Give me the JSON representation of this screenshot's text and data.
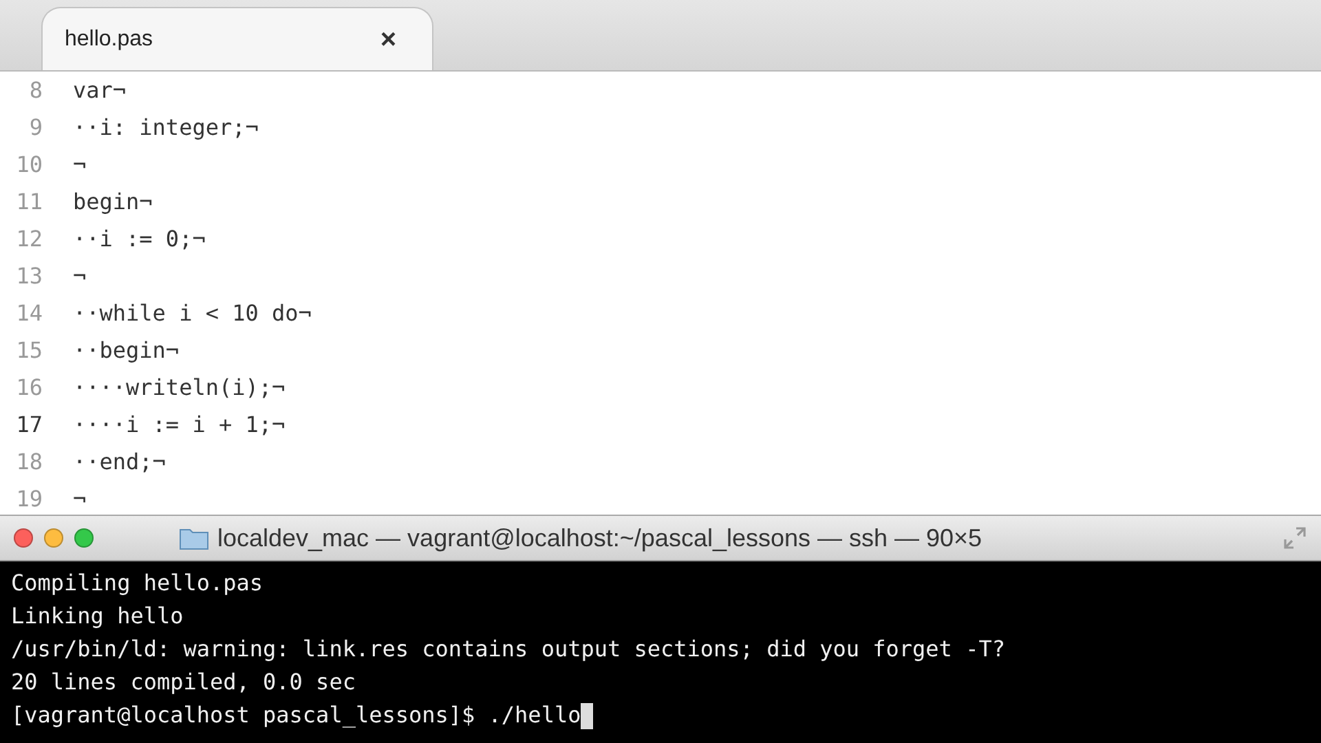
{
  "editor": {
    "tabs": [
      {
        "label": "hello.pas",
        "selected": true,
        "close": "×"
      }
    ],
    "lines": [
      {
        "number": "8",
        "text": "var¬",
        "current": false
      },
      {
        "number": "9",
        "text": "··i: integer;¬",
        "current": false
      },
      {
        "number": "10",
        "text": "¬",
        "current": false
      },
      {
        "number": "11",
        "text": "begin¬",
        "current": false
      },
      {
        "number": "12",
        "text": "··i := 0;¬",
        "current": false
      },
      {
        "number": "13",
        "text": "¬",
        "current": false
      },
      {
        "number": "14",
        "text": "··while i < 10 do¬",
        "current": false
      },
      {
        "number": "15",
        "text": "··begin¬",
        "current": false
      },
      {
        "number": "16",
        "text": "····writeln(i);¬",
        "current": false
      },
      {
        "number": "17",
        "text": "····i := i + 1;¬",
        "current": true
      },
      {
        "number": "18",
        "text": "··end;¬",
        "current": false
      },
      {
        "number": "19",
        "text": "¬",
        "current": false
      }
    ]
  },
  "terminal": {
    "title": "localdev_mac — vagrant@localhost:~/pascal_lessons — ssh — 90×5",
    "output": [
      "Compiling hello.pas",
      "Linking hello",
      "/usr/bin/ld: warning: link.res contains output sections; did you forget -T?",
      "20 lines compiled, 0.0 sec"
    ],
    "prompt": "[vagrant@localhost pascal_lessons]$ ./hello"
  }
}
